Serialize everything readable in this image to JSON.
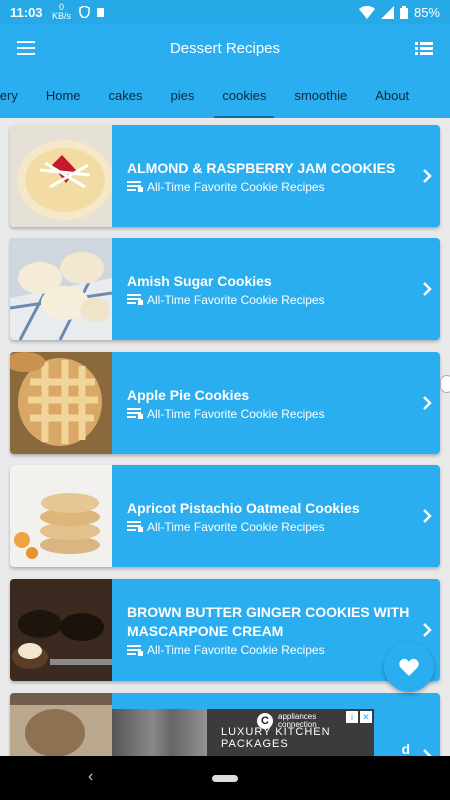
{
  "status": {
    "time": "11:03",
    "net_speed": "0 KB/s",
    "battery": "85%"
  },
  "appbar": {
    "title": "Dessert Recipes"
  },
  "tabs": [
    {
      "label": "llery"
    },
    {
      "label": "Home"
    },
    {
      "label": "cakes"
    },
    {
      "label": "pies"
    },
    {
      "label": "cookies",
      "active": true
    },
    {
      "label": "smoothie"
    },
    {
      "label": "About"
    }
  ],
  "recipes": [
    {
      "title": "ALMOND & RASPBERRY JAM COOKIES",
      "subtitle": "All-Time Favorite Cookie Recipes",
      "thumb": "jam-cookie"
    },
    {
      "title": "Amish Sugar Cookies",
      "subtitle": "All-Time Favorite Cookie Recipes",
      "thumb": "sugar-cookies"
    },
    {
      "title": "Apple Pie Cookies",
      "subtitle": "All-Time Favorite Cookie Recipes",
      "thumb": "lattice-cookie"
    },
    {
      "title": "Apricot Pistachio Oatmeal Cookies",
      "subtitle": "All-Time Favorite Cookie Recipes",
      "thumb": "oatmeal-stack"
    },
    {
      "title": "BROWN BUTTER GINGER COOKIES WITH MASCARPONE CREAM",
      "subtitle": "All-Time Favorite Cookie Recipes",
      "thumb": "ginger-cookies"
    },
    {
      "title": "d",
      "subtitle": "",
      "thumb": "kitchen"
    }
  ],
  "ad": {
    "brand_line1": "appliances",
    "brand_line2": "connection",
    "tagline": "LUXURY KITCHEN PACKAGES"
  },
  "colors": {
    "primary": "#2aaef0",
    "statusbar": "#27a9e8",
    "background": "#e9e9e9"
  }
}
